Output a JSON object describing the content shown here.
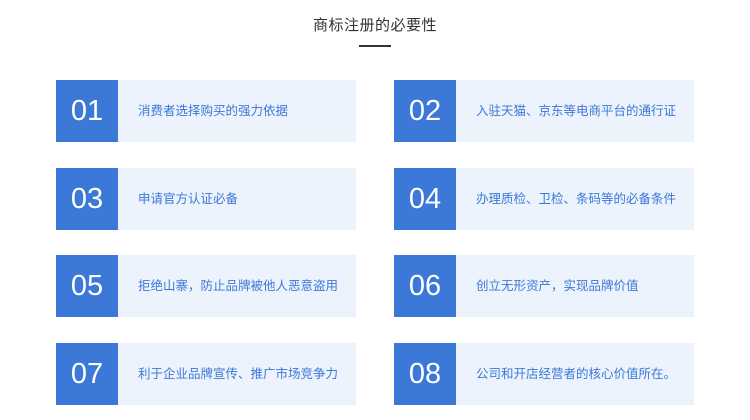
{
  "title": "商标注册的必要性",
  "colors": {
    "accent": "#3b78d7",
    "card_bg": "#edf3fc",
    "title": "#333333"
  },
  "items": [
    {
      "number": "01",
      "text": "消费者选择购买的强力依据"
    },
    {
      "number": "02",
      "text": "入驻天猫、京东等电商平台的通行证"
    },
    {
      "number": "03",
      "text": "申请官方认证必备"
    },
    {
      "number": "04",
      "text": "办理质检、卫检、条码等的必备条件"
    },
    {
      "number": "05",
      "text": "拒绝山寨，防止品牌被他人恶意盗用"
    },
    {
      "number": "06",
      "text": "创立无形资产，实现品牌价值"
    },
    {
      "number": "07",
      "text": "利于企业品牌宣传、推广市场竞争力"
    },
    {
      "number": "08",
      "text": "公司和开店经营者的核心价值所在。"
    }
  ]
}
